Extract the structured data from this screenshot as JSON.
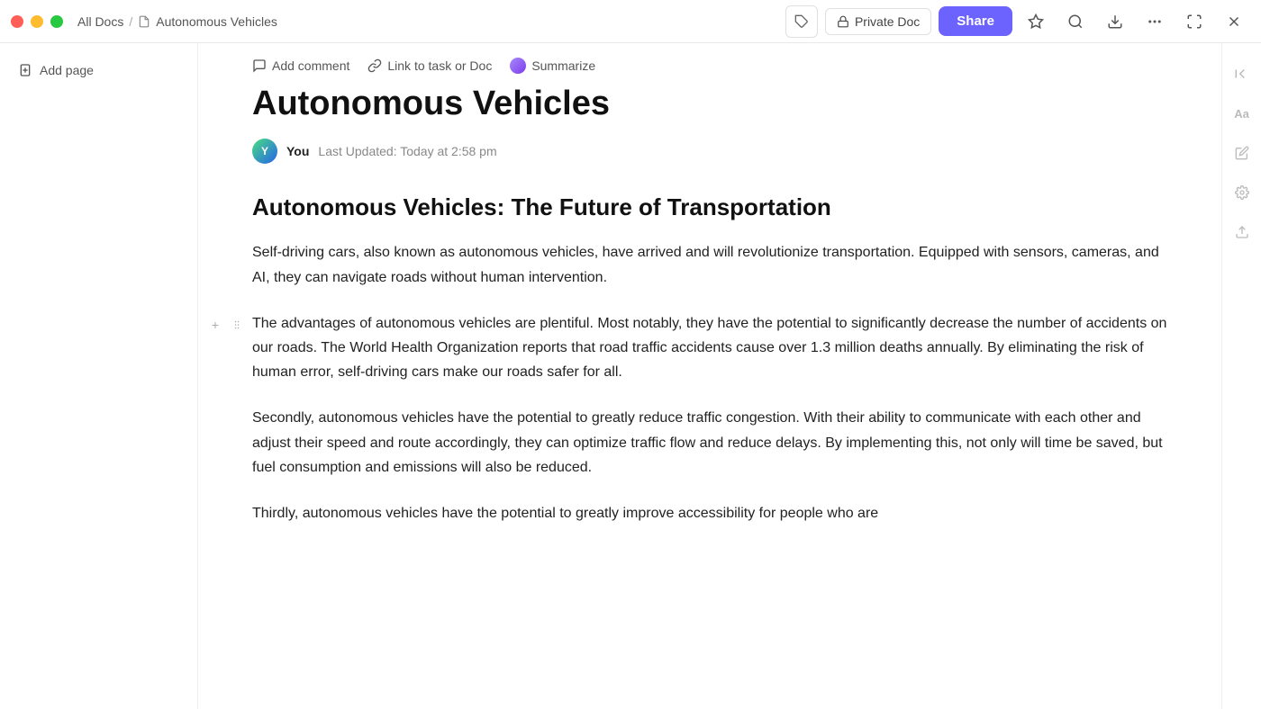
{
  "titlebar": {
    "breadcrumb_all": "All Docs",
    "breadcrumb_sep": "/",
    "breadcrumb_doc": "Autonomous Vehicles",
    "private_doc_label": "Private Doc",
    "share_label": "Share"
  },
  "sidebar": {
    "add_page_label": "Add page"
  },
  "doc_toolbar": {
    "comment_label": "Add comment",
    "link_label": "Link to task or Doc",
    "summarize_label": "Summarize"
  },
  "document": {
    "title": "Autonomous Vehicles",
    "author_name": "You",
    "last_updated": "Last Updated: Today at 2:58 pm",
    "heading1": "Autonomous Vehicles: The Future of Transportation",
    "paragraph1": "Self-driving cars, also known as autonomous vehicles, have arrived and will revolutionize transportation. Equipped with sensors, cameras, and AI, they can navigate roads without human intervention.",
    "paragraph2": "The advantages of autonomous vehicles are plentiful. Most notably, they have the potential to significantly decrease the number of accidents on our roads. The World Health Organization reports that road traffic accidents cause over 1.3 million deaths annually. By eliminating the risk of human error, self-driving cars make our roads safer for all.",
    "paragraph3": "Secondly, autonomous vehicles have the potential to greatly reduce traffic congestion. With their ability to communicate with each other and adjust their speed and route accordingly, they can optimize traffic flow and reduce delays. By implementing this, not only will time be saved, but fuel consumption and emissions will also be reduced.",
    "paragraph4": "Thirdly, autonomous vehicles have the potential to greatly improve accessibility for people who are"
  },
  "icons": {
    "add_page": "⊕",
    "tag": "◇",
    "lock": "🔒",
    "star": "☆",
    "search": "⌕",
    "export": "⤓",
    "more": "···",
    "expand": "⤢",
    "close": "×",
    "comment": "○",
    "link": "↗",
    "drag_handle": "⠿",
    "add_block": "+",
    "collapse_sidebar": "⇥",
    "font_size": "Aa",
    "share_icon": "↗",
    "settings_icon": "✦",
    "upload_icon": "↑"
  }
}
